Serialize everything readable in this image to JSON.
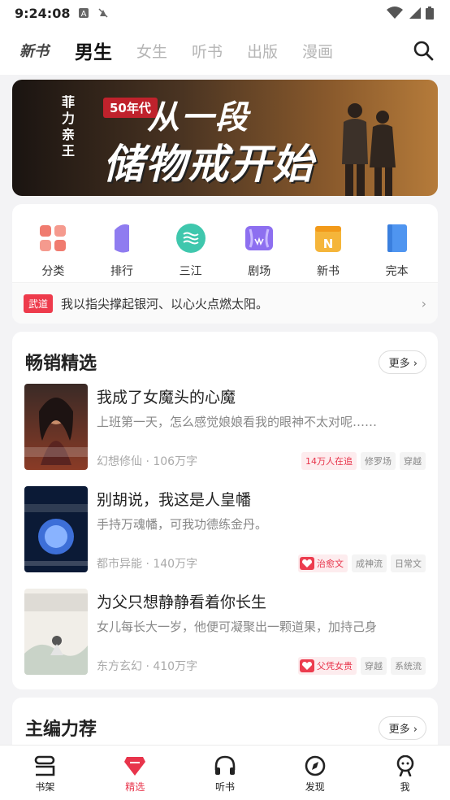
{
  "status_bar": {
    "time": "9:24:08"
  },
  "top_nav": {
    "logo": "新书",
    "tabs": [
      {
        "label": "男生",
        "active": true
      },
      {
        "label": "女生",
        "active": false
      },
      {
        "label": "听书",
        "active": false
      },
      {
        "label": "出版",
        "active": false
      },
      {
        "label": "漫画",
        "active": false
      }
    ]
  },
  "banner": {
    "author": "菲力亲王",
    "era_badge": "50年代",
    "title_line1": "从一段",
    "title_line2": "储物戒开始"
  },
  "categories": [
    {
      "label": "分类",
      "icon": "grid-icon",
      "color": "#f07b6f"
    },
    {
      "label": "排行",
      "icon": "ranking-icon",
      "color": "#8f7cf0"
    },
    {
      "label": "三江",
      "icon": "sanjiang-icon",
      "color": "#3fc7ad"
    },
    {
      "label": "剧场",
      "icon": "theater-icon",
      "color": "#8d6ff0"
    },
    {
      "label": "新书",
      "icon": "new-book-icon",
      "color": "#f5b53a"
    },
    {
      "label": "完本",
      "icon": "complete-book-icon",
      "color": "#4f95f0"
    }
  ],
  "ticker": {
    "tag": "武道",
    "text": "我以指尖撑起银河、以心火点燃太阳。"
  },
  "bestsellers": {
    "title": "畅销精选",
    "more": "更多",
    "books": [
      {
        "title": "我成了女魔头的心魔",
        "description": "上班第一天，怎么感觉娘娘看我的眼神不太对呢……",
        "genre": "幻想修仙",
        "words": "106万字",
        "tags": [
          {
            "text": "14万人在追",
            "style": "hot"
          },
          {
            "text": "修罗场",
            "style": "plain"
          },
          {
            "text": "穿越",
            "style": "plain"
          }
        ]
      },
      {
        "title": "别胡说，我这是人皇幡",
        "description": "手持万魂幡，可我功德练金丹。",
        "genre": "都市异能",
        "words": "140万字",
        "tags": [
          {
            "text": "治愈文",
            "style": "highlight"
          },
          {
            "text": "成神流",
            "style": "plain"
          },
          {
            "text": "日常文",
            "style": "plain"
          }
        ]
      },
      {
        "title": "为父只想静静看着你长生",
        "description": "女儿每长大一岁，他便可凝聚出一颗道果，加持己身",
        "genre": "东方玄幻",
        "words": "410万字",
        "tags": [
          {
            "text": "父凭女贵",
            "style": "highlight"
          },
          {
            "text": "穿越",
            "style": "plain"
          },
          {
            "text": "系统流",
            "style": "plain"
          }
        ]
      }
    ]
  },
  "editor_picks": {
    "title": "主编力荐",
    "more": "更多"
  },
  "bottom_nav": [
    {
      "label": "书架",
      "icon": "bookshelf-icon",
      "active": false
    },
    {
      "label": "精选",
      "icon": "featured-icon",
      "active": true
    },
    {
      "label": "听书",
      "icon": "headphones-icon",
      "active": false
    },
    {
      "label": "发现",
      "icon": "compass-icon",
      "active": false
    },
    {
      "label": "我",
      "icon": "profile-icon",
      "active": false
    }
  ],
  "colors": {
    "accent": "#e8344b",
    "background": "#f3f3f5"
  }
}
